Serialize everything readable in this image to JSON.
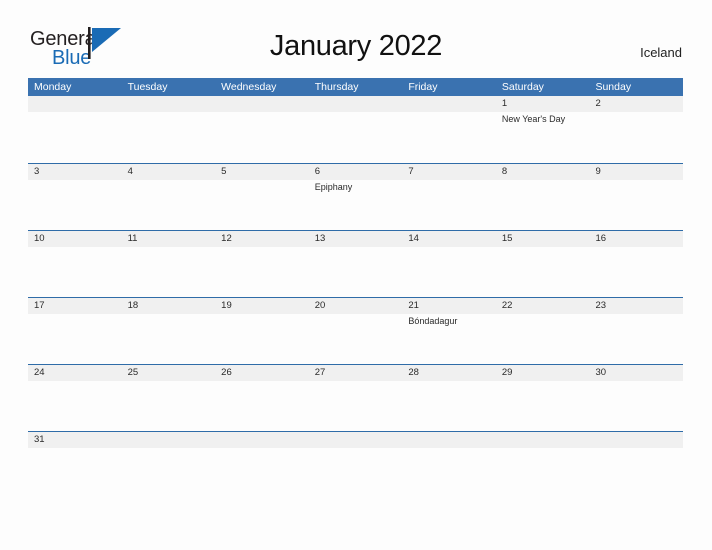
{
  "brand": {
    "name_part1": "General",
    "name_part2": "Blue",
    "flag_icon": "flag-triangle-icon",
    "color_dark": "#231f20",
    "color_blue": "#1a6bb5"
  },
  "header": {
    "title": "January 2022",
    "country": "Iceland"
  },
  "colors": {
    "header_blue": "#3a72b0",
    "row_divider_blue": "#2f6ca8",
    "date_band_gray": "#f0f0f0",
    "page_background": "#fdfdfd",
    "text": "#2a2a2a"
  },
  "calendar": {
    "month": "January",
    "year": "2022",
    "first_day_of_week": "Monday",
    "weekdays": [
      "Monday",
      "Tuesday",
      "Wednesday",
      "Thursday",
      "Friday",
      "Saturday",
      "Sunday"
    ],
    "weeks": [
      {
        "days": [
          {
            "date": "",
            "event": ""
          },
          {
            "date": "",
            "event": ""
          },
          {
            "date": "",
            "event": ""
          },
          {
            "date": "",
            "event": ""
          },
          {
            "date": "",
            "event": ""
          },
          {
            "date": "1",
            "event": "New Year's Day"
          },
          {
            "date": "2",
            "event": ""
          }
        ]
      },
      {
        "days": [
          {
            "date": "3",
            "event": ""
          },
          {
            "date": "4",
            "event": ""
          },
          {
            "date": "5",
            "event": ""
          },
          {
            "date": "6",
            "event": "Epiphany"
          },
          {
            "date": "7",
            "event": ""
          },
          {
            "date": "8",
            "event": ""
          },
          {
            "date": "9",
            "event": ""
          }
        ]
      },
      {
        "days": [
          {
            "date": "10",
            "event": ""
          },
          {
            "date": "11",
            "event": ""
          },
          {
            "date": "12",
            "event": ""
          },
          {
            "date": "13",
            "event": ""
          },
          {
            "date": "14",
            "event": ""
          },
          {
            "date": "15",
            "event": ""
          },
          {
            "date": "16",
            "event": ""
          }
        ]
      },
      {
        "days": [
          {
            "date": "17",
            "event": ""
          },
          {
            "date": "18",
            "event": ""
          },
          {
            "date": "19",
            "event": ""
          },
          {
            "date": "20",
            "event": ""
          },
          {
            "date": "21",
            "event": "Bóndadagur"
          },
          {
            "date": "22",
            "event": ""
          },
          {
            "date": "23",
            "event": ""
          }
        ]
      },
      {
        "days": [
          {
            "date": "24",
            "event": ""
          },
          {
            "date": "25",
            "event": ""
          },
          {
            "date": "26",
            "event": ""
          },
          {
            "date": "27",
            "event": ""
          },
          {
            "date": "28",
            "event": ""
          },
          {
            "date": "29",
            "event": ""
          },
          {
            "date": "30",
            "event": ""
          }
        ]
      },
      {
        "days": [
          {
            "date": "31",
            "event": ""
          },
          {
            "date": "",
            "event": ""
          },
          {
            "date": "",
            "event": ""
          },
          {
            "date": "",
            "event": ""
          },
          {
            "date": "",
            "event": ""
          },
          {
            "date": "",
            "event": ""
          },
          {
            "date": "",
            "event": ""
          }
        ]
      }
    ]
  }
}
